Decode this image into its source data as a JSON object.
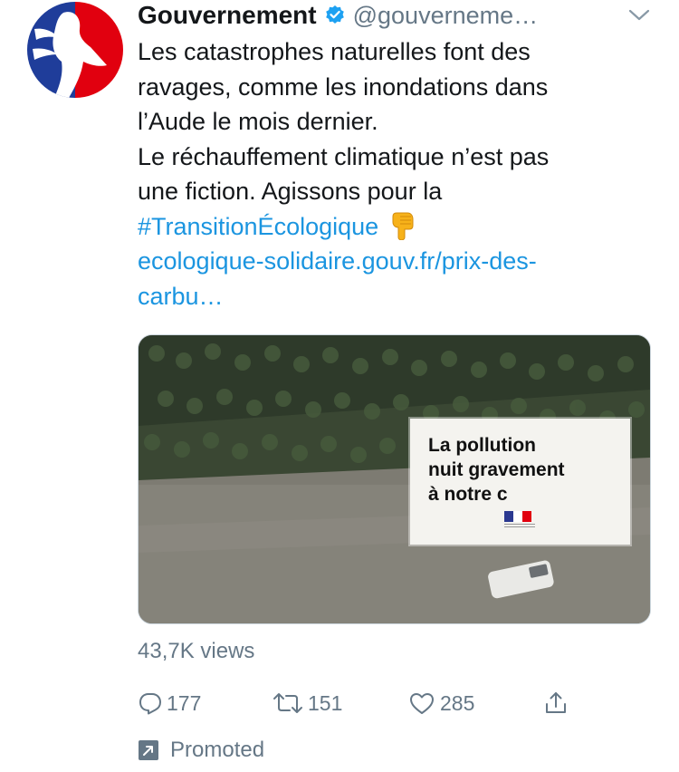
{
  "tweet": {
    "author": {
      "display_name": "Gouvernement",
      "verified_icon": "verified-badge-icon",
      "handle": "@gouverneme…"
    },
    "text_lines": [
      "Les catastrophes naturelles font des",
      "ravages, comme les inondations dans",
      "l’Aude le mois dernier.",
      "Le réchauffement climatique n’est pas",
      "une fiction. Agissons pour la"
    ],
    "hashtag": "#TransitionÉcologique",
    "link_lines": [
      "ecologique-solidaire.gouv.fr/prix-des-",
      "carbu…"
    ],
    "media": {
      "overlay_text": "La pollution\nnuit gravement\nà notre c"
    },
    "views": "43,7K views",
    "actions": {
      "reply_count": "177",
      "retweet_count": "151",
      "like_count": "285"
    },
    "promoted_label": "Promoted"
  },
  "colors": {
    "link": "#1b95e0",
    "secondary_text": "#657786",
    "primary_text": "#14171a",
    "verified": "#1da1f2",
    "flag_blue": "#2b3990",
    "flag_red": "#e1000f"
  }
}
